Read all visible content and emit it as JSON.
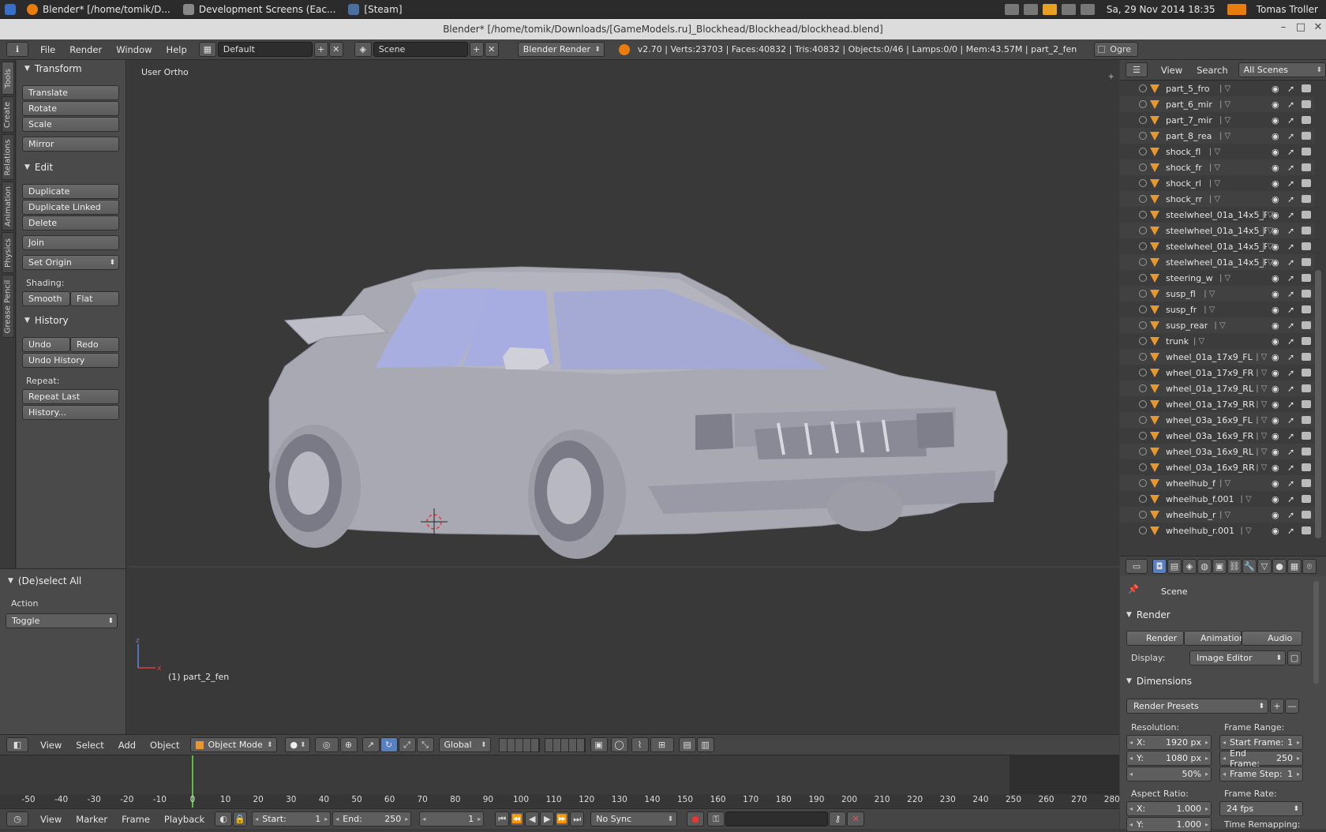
{
  "system_bar": {
    "tasks": [
      "Blender* [/home/tomik/D...",
      "Development Screens (Eac...",
      "[Steam]"
    ],
    "datetime": "Sa, 29 Nov 2014 18:35",
    "user": "Tomas Troller"
  },
  "window": {
    "title": "Blender* [/home/tomik/Downloads/[GameModels.ru]_Blockhead/Blockhead/blockhead.blend]"
  },
  "info_header": {
    "menus": [
      "File",
      "Render",
      "Window",
      "Help"
    ],
    "screen_layout": "Default",
    "scene": "Scene",
    "engine": "Blender Render",
    "stats": "v2.70 | Verts:23703 | Faces:40832 | Tris:40832 | Objects:0/46 | Lamps:0/0 | Mem:43.57M | part_2_fen",
    "ogre_label": "Ogre"
  },
  "vertical_tabs": [
    "Tools",
    "Create",
    "Relations",
    "Animation",
    "Physics",
    "Grease Pencil"
  ],
  "tool_shelf": {
    "transform": {
      "title": "Transform",
      "buttons": [
        "Translate",
        "Rotate",
        "Scale",
        "Mirror"
      ]
    },
    "edit": {
      "title": "Edit",
      "buttons": [
        "Duplicate",
        "Duplicate Linked",
        "Delete",
        "Join"
      ],
      "set_origin": "Set Origin",
      "shading_label": "Shading:",
      "smooth": "Smooth",
      "flat": "Flat"
    },
    "history": {
      "title": "History",
      "undo": "Undo",
      "redo": "Redo",
      "undo_history": "Undo History",
      "repeat_label": "Repeat:",
      "repeat_last": "Repeat Last",
      "history_btn": "History..."
    }
  },
  "operator_panel": {
    "title": "(De)select All",
    "action_label": "Action",
    "action_value": "Toggle"
  },
  "viewport": {
    "view_label": "User Ortho",
    "object_label": "(1) part_2_fen"
  },
  "view3d_header": {
    "menus": [
      "View",
      "Select",
      "Add",
      "Object"
    ],
    "mode": "Object Mode",
    "orientation": "Global"
  },
  "timeline": {
    "ticks": [
      -50,
      -40,
      -30,
      -20,
      -10,
      0,
      10,
      20,
      30,
      40,
      50,
      60,
      70,
      80,
      90,
      100,
      110,
      120,
      130,
      140,
      150,
      160,
      170,
      180,
      190,
      200,
      210,
      220,
      230,
      240,
      250,
      260,
      270,
      280
    ],
    "current_frame": 1
  },
  "timeline_header": {
    "menus": [
      "View",
      "Marker",
      "Frame",
      "Playback"
    ],
    "start_label": "Start:",
    "start_value": "1",
    "end_label": "End:",
    "end_value": "250",
    "current": "1",
    "sync": "No Sync"
  },
  "outliner": {
    "menus": [
      "View",
      "Search"
    ],
    "filter": "All Scenes",
    "items": [
      "part_5_fro",
      "part_6_mir",
      "part_7_mir",
      "part_8_rea",
      "shock_fl",
      "shock_fr",
      "shock_rl",
      "shock_rr",
      "steelwheel_01a_14x5_Fl",
      "steelwheel_01a_14x5_Fl",
      "steelwheel_01a_14x5_Rl",
      "steelwheel_01a_14x5_Rl",
      "steering_w",
      "susp_fl",
      "susp_fr",
      "susp_rear",
      "trunk",
      "wheel_01a_17x9_FL",
      "wheel_01a_17x9_FR",
      "wheel_01a_17x9_RL",
      "wheel_01a_17x9_RR",
      "wheel_03a_16x9_FL",
      "wheel_03a_16x9_FR",
      "wheel_03a_16x9_RL",
      "wheel_03a_16x9_RR",
      "wheelhub_f",
      "wheelhub_f.001",
      "wheelhub_r",
      "wheelhub_r.001"
    ]
  },
  "properties": {
    "context": "Scene",
    "render_panel": "Render",
    "render_btn": "Render",
    "animation_btn": "Animation",
    "audio_btn": "Audio",
    "display_label": "Display:",
    "display_value": "Image Editor",
    "dimensions_panel": "Dimensions",
    "presets": "Render Presets",
    "resolution_label": "Resolution:",
    "res_x_label": "X:",
    "res_x": "1920 px",
    "res_y_label": "Y:",
    "res_y": "1080 px",
    "res_pct": "50%",
    "frame_range_label": "Frame Range:",
    "start_frame_label": "Start Frame:",
    "start_frame": "1",
    "end_frame_label": "End Frame:",
    "end_frame": "250",
    "frame_step_label": "Frame Step:",
    "frame_step": "1",
    "aspect_label": "Aspect Ratio:",
    "asp_x_label": "X:",
    "asp_x": "1.000",
    "asp_y_label": "Y:",
    "asp_y": "1.000",
    "frame_rate_label": "Frame Rate:",
    "fps": "24 fps",
    "time_remap_label": "Time Remapping:"
  }
}
